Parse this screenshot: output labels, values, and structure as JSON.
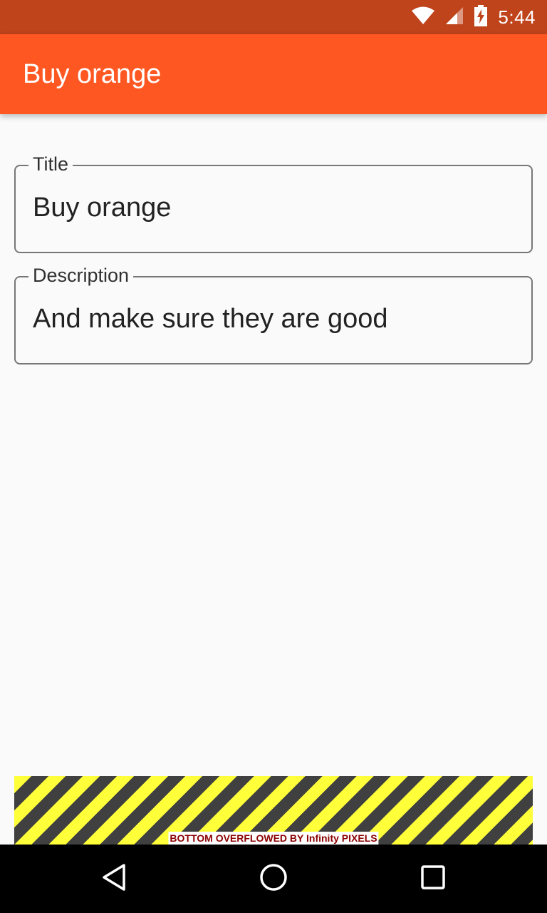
{
  "status_bar": {
    "time": "5:44",
    "icons": [
      "wifi-icon",
      "cell-signal-icon",
      "battery-charging-icon"
    ]
  },
  "app_bar": {
    "title": "Buy orange"
  },
  "form": {
    "title_field": {
      "label": "Title",
      "value": "Buy orange"
    },
    "description_field": {
      "label": "Description",
      "value": "And make sure they are good"
    }
  },
  "overflow_warning": {
    "text": "BOTTOM OVERFLOWED BY Infinity PIXELS"
  },
  "nav_bar": {
    "buttons": [
      "back-icon",
      "home-icon",
      "recents-icon"
    ]
  },
  "colors": {
    "status_bar": "#bf441c",
    "app_bar": "#ff5722",
    "background": "#fafafa",
    "stripe_yellow": "#ffff3a",
    "stripe_dark": "#404040",
    "overflow_text": "#8b0000"
  }
}
